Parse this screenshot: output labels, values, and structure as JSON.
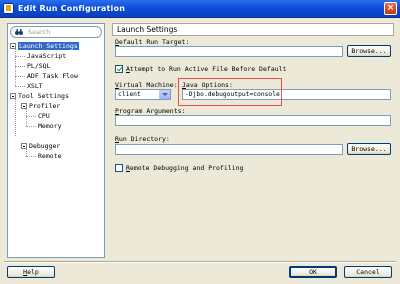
{
  "window": {
    "title": "Edit Run Configuration",
    "close_glyph": "×"
  },
  "navigator": {
    "search_placeholder": "Search",
    "tree": [
      {
        "label": "Launch Settings",
        "selected": true
      },
      {
        "label": "JavaScript"
      },
      {
        "label": "PL/SQL"
      },
      {
        "label": "ADF Task Flow"
      },
      {
        "label": "XSLT"
      },
      {
        "label": "Tool Settings"
      },
      {
        "label": "Profiler"
      },
      {
        "label": "CPU"
      },
      {
        "label": "Memory"
      },
      {
        "label": "Debugger"
      },
      {
        "label": "Remote"
      }
    ]
  },
  "main": {
    "section_title": "Launch Settings",
    "default_run_target_label": "Default Run Target:",
    "default_run_target_value": "",
    "browse_label": "Browse...",
    "attempt_checkbox_label": "Attempt to Run Active File Before Default",
    "attempt_checked": true,
    "virtual_machine_label": "Virtual Machine:",
    "virtual_machine_value": "client",
    "java_options_label": "Java Options:",
    "java_options_value": "-Djbo.debugoutput=console",
    "program_arguments_label": "Program Arguments:",
    "program_arguments_value": "",
    "run_directory_label": "Run Directory:",
    "run_directory_value": "",
    "run_dir_browse_label": "Browse...",
    "remote_debug_label": "Remote Debugging and Profiling",
    "remote_debug_checked": false
  },
  "footer": {
    "help_label": "Help",
    "ok_label": "OK",
    "cancel_label": "Cancel"
  },
  "colors": {
    "titlebar": "#0a4ed8",
    "selection": "#316ac5",
    "highlight": "#e05050"
  }
}
